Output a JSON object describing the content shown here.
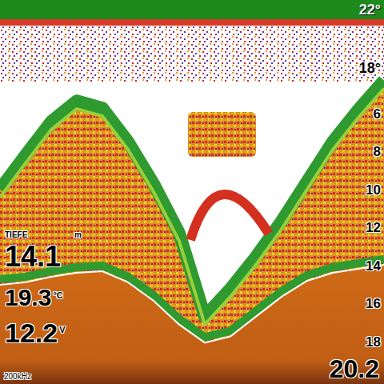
{
  "surface_temps": [
    "22°",
    "18°"
  ],
  "depth_scale": [
    "6",
    "8",
    "10",
    "12",
    "14",
    "16",
    "18"
  ],
  "readouts": {
    "depth": {
      "label": "TIEFE",
      "unit": "m",
      "value": "14.1"
    },
    "water_temp": {
      "value": "19.3",
      "unit": "°C"
    },
    "voltage": {
      "value": "12.2",
      "unit": "V"
    }
  },
  "frequency": "200kHz",
  "range": "20.2",
  "bottom_chart": {
    "ridge_top_m": [
      9.96,
      8.16,
      6.4,
      5.31,
      5.69,
      7.45,
      9.67,
      12.26,
      16.65,
      15.19,
      13.51,
      11.63,
      9.54,
      7.45,
      5.77,
      4.23
    ],
    "hard_bottom_m": [
      14.98,
      14.85,
      14.56,
      14.35,
      14.27,
      14.85,
      15.82,
      17.07,
      18.03,
      17.7,
      16.65,
      15.61,
      14.77,
      14.35,
      14.14,
      13.93
    ]
  }
}
